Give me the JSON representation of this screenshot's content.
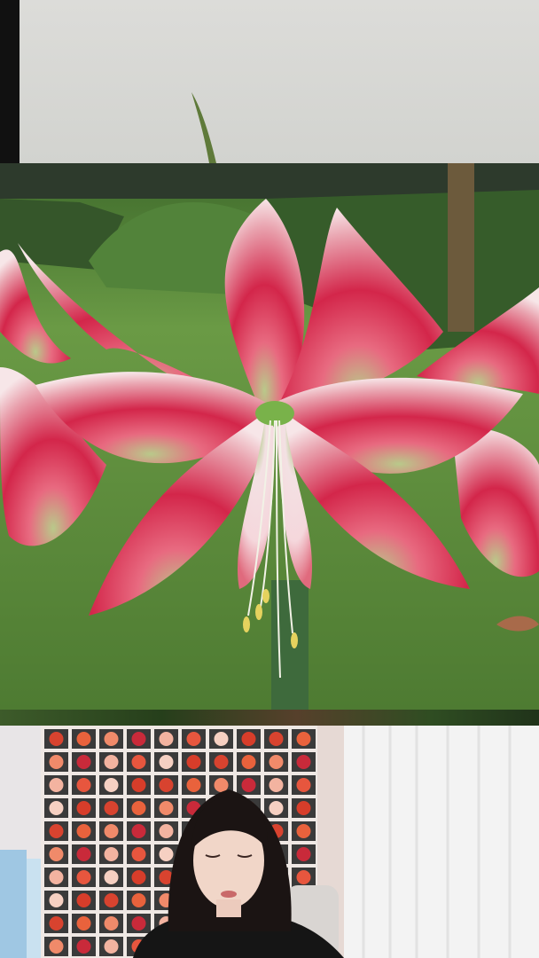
{
  "scene": {
    "top": {
      "description_icon": "plant-stem-icon",
      "colors": {
        "wall": "#d6d6d3",
        "stem": "#5f7a3a"
      }
    },
    "middle": {
      "subject": "amaryllis-flower-icon",
      "colors": {
        "petal_red": "#d72a4a",
        "petal_white": "#f6eaea",
        "grass": "#5c8a3a",
        "throat": "#7ab24a"
      }
    },
    "bottom": {
      "subject": "person-icon",
      "colors": {
        "poster_bg": "#efe8e4",
        "curtain": "#f4f4f4",
        "shirt": "#151515",
        "hair": "#1b1413"
      }
    }
  }
}
